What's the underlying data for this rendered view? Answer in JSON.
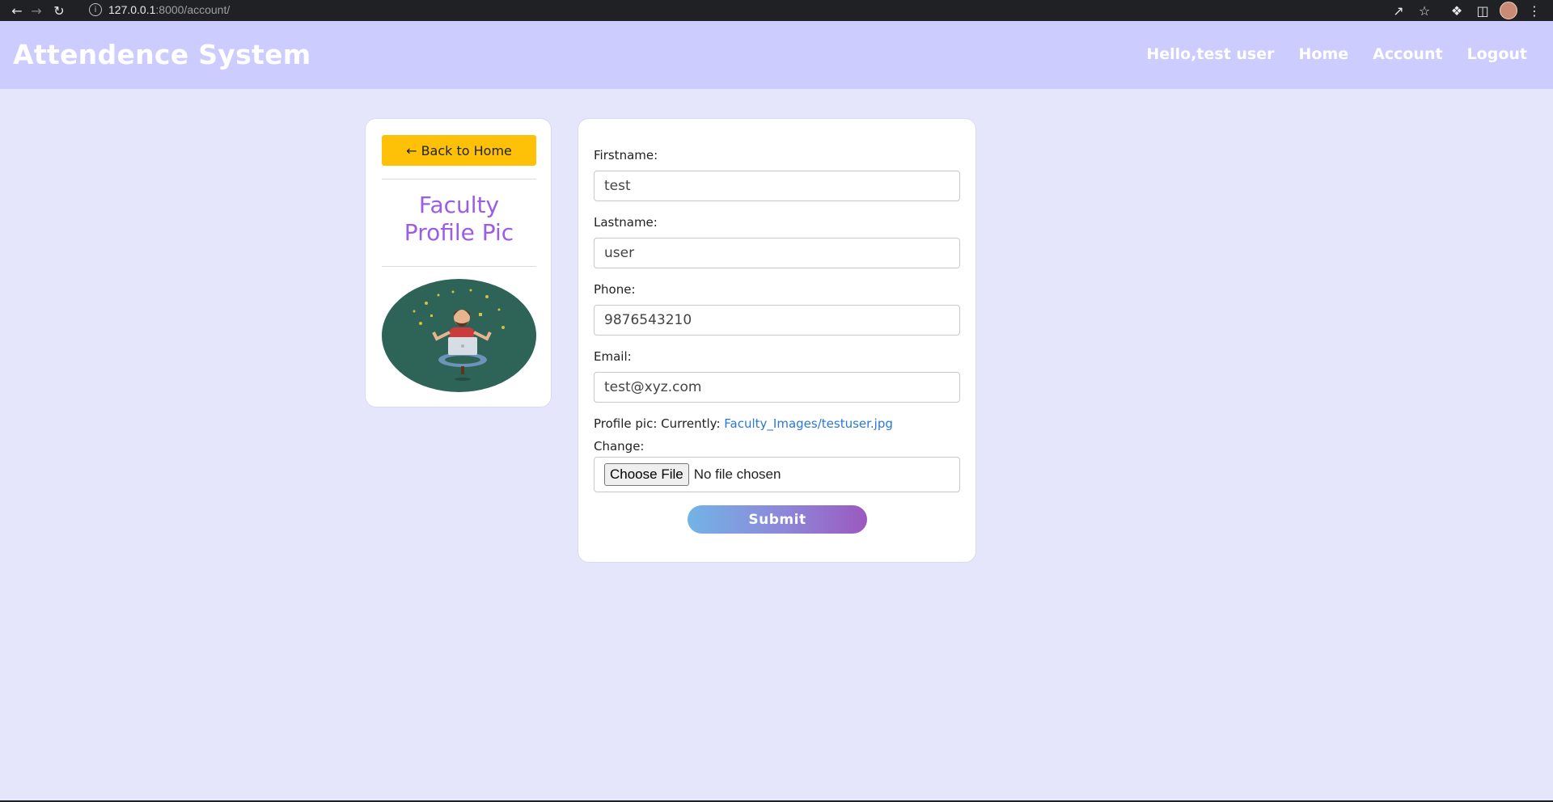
{
  "browser": {
    "url_host": "127.0.0.1",
    "url_rest": ":8000/account/"
  },
  "navbar": {
    "brand": "Attendence System",
    "links": [
      "Hello,test user",
      "Home",
      "Account",
      "Logout"
    ]
  },
  "left_card": {
    "back_label": "← Back to Home",
    "title_line1": "Faculty",
    "title_line2": "Profile Pic"
  },
  "form": {
    "firstname_label": "Firstname:",
    "firstname_value": "test",
    "lastname_label": "Lastname:",
    "lastname_value": "user",
    "phone_label": "Phone:",
    "phone_value": "9876543210",
    "email_label": "Email:",
    "email_value": "test@xyz.com",
    "profile_pic_prefix": "Profile pic: Currently:",
    "profile_pic_link": "Faculty_Images/testuser.jpg",
    "change_label": "Change:",
    "choose_file_label": "Choose File",
    "no_file_text": "No file chosen",
    "submit_label": "Submit"
  },
  "colors": {
    "page_bg": "#e5e5fc",
    "navbar_bg": "#ccccff",
    "back_button": "#ffc107",
    "title_purple": "#9b5de5",
    "link_blue": "#2a78d8"
  }
}
